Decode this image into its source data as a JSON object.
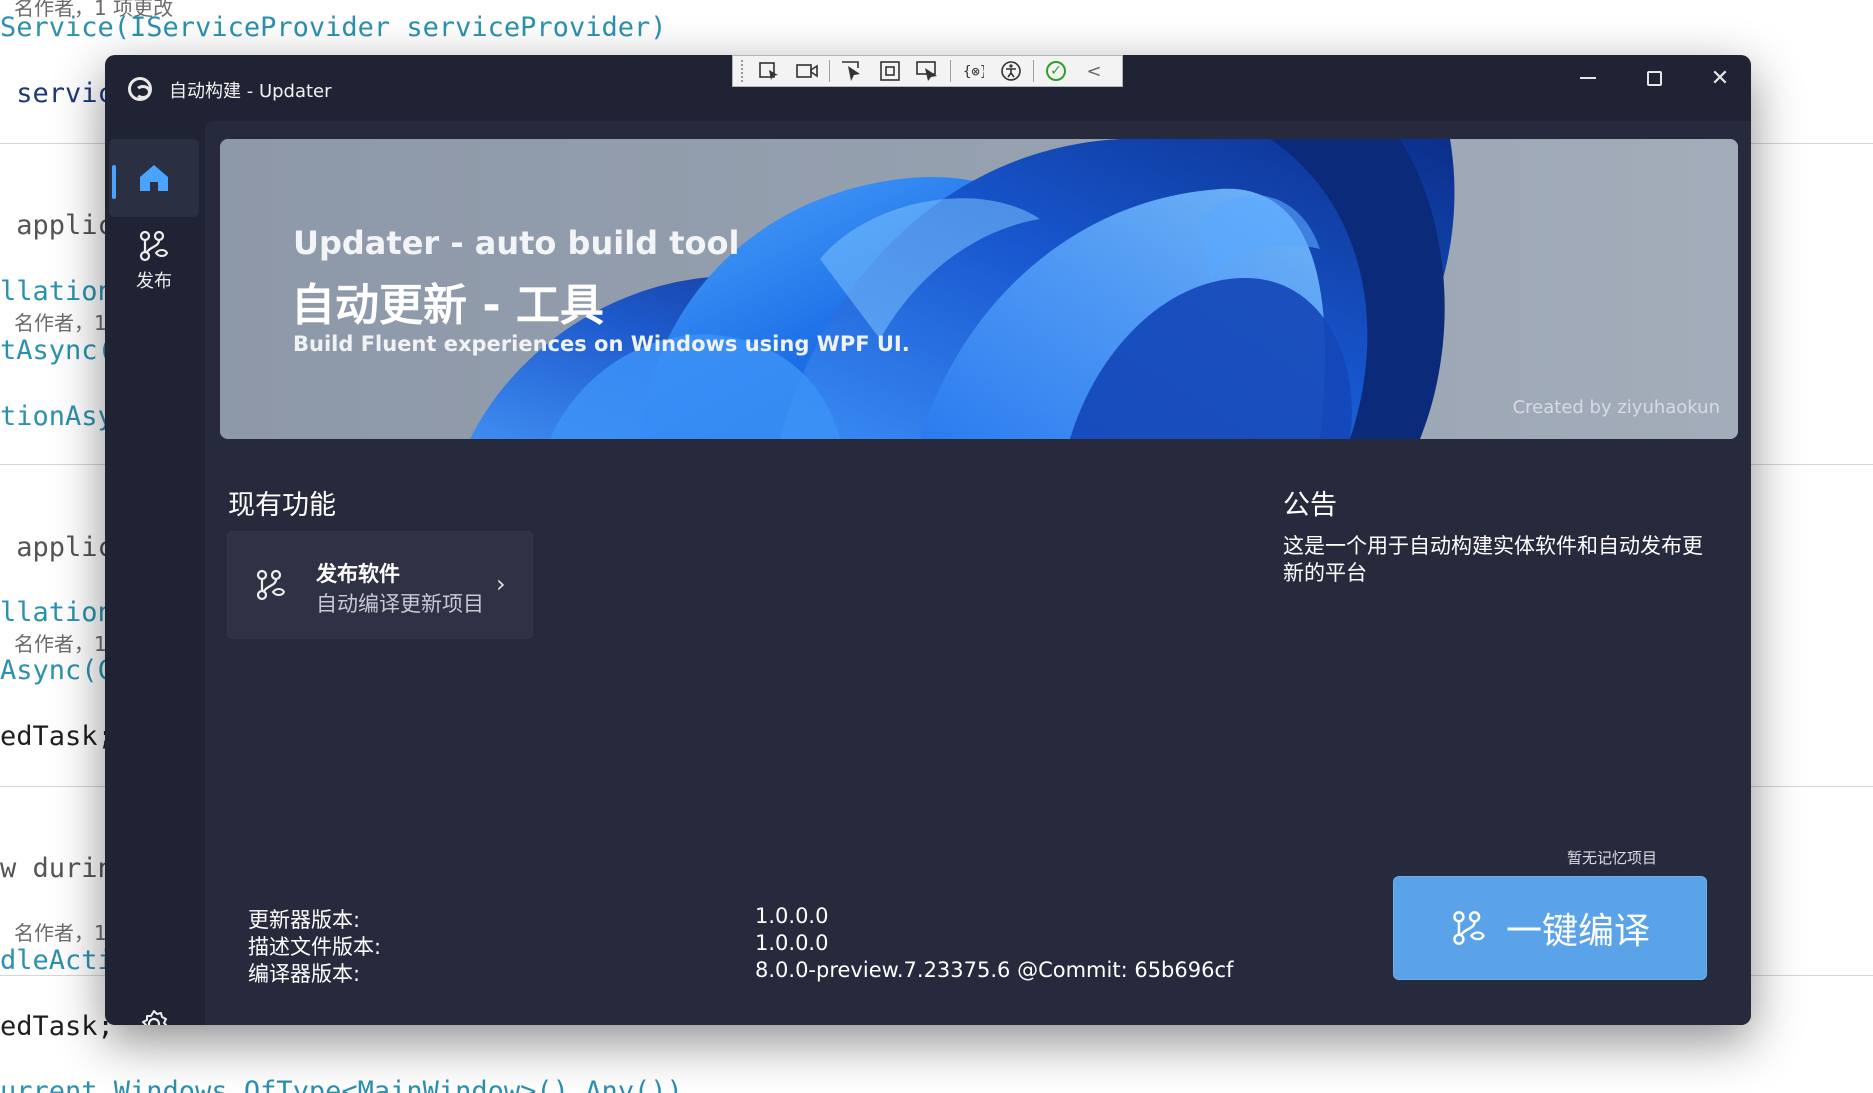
{
  "background_editor": {
    "lines": [
      {
        "code": "名作者，1 项更改",
        "type": "hint"
      },
      {
        "code": "Service(IServiceProvider serviceProvider)",
        "type": "code"
      },
      {
        "code": " servic",
        "type": "code"
      },
      {
        "code": " applic",
        "type": "code"
      },
      {
        "code": "llation",
        "type": "code"
      },
      {
        "code": "名作者，1",
        "type": "hint"
      },
      {
        "code": "tAsync(",
        "type": "code"
      },
      {
        "code": "tionAsy",
        "type": "code"
      },
      {
        "code": " applic",
        "type": "code"
      },
      {
        "code": "llation",
        "type": "code"
      },
      {
        "code": "名作者，1",
        "type": "hint"
      },
      {
        "code": "Async(C",
        "type": "code"
      },
      {
        "code": "edTask;",
        "type": "code"
      },
      {
        "code": "w durin",
        "type": "code"
      },
      {
        "code": "名作者，1",
        "type": "hint"
      },
      {
        "code": "dleActi",
        "type": "code"
      },
      {
        "code": "edTask;",
        "type": "code"
      },
      {
        "code": "urrent.Windows.OfType<MainWindow>().Any())",
        "type": "code"
      }
    ]
  },
  "window": {
    "title": "自动构建 - Updater",
    "minimize_glyph": "—",
    "close_glyph": "✕"
  },
  "debug_toolbar": {
    "icons": [
      "select-element-icon",
      "record-icon",
      "pointer-icon",
      "layout-adorner-icon",
      "track-focus-icon",
      "binding-failures-icon",
      "accessibility-icon",
      "checkmark-icon",
      "collapse-icon"
    ],
    "collapse_glyph": "<",
    "check_glyph": "✓"
  },
  "nav": {
    "home_label": "",
    "publish_label": "发布",
    "settings_label": "设置",
    "accent": "#4aa3ff"
  },
  "banner": {
    "en_title": "Updater - auto build tool",
    "cn_title": "自动更新 - 工具",
    "subtitle": "Build Fluent experiences on Windows using WPF UI.",
    "credit": "Created by ziyuhaokun"
  },
  "features": {
    "title": "现有功能",
    "card": {
      "title": "发布软件",
      "description": "自动编译更新项目",
      "chevron": "›"
    }
  },
  "notice": {
    "title": "公告",
    "text": "这是一个用于自动构建实体软件和自动发布更新的平台"
  },
  "versions": [
    {
      "label": "更新器版本:",
      "value": "1.0.0.0"
    },
    {
      "label": "描述文件版本:",
      "value": "1.0.0.0"
    },
    {
      "label": "编译器版本:",
      "value": "8.0.0-preview.7.23375.6 @Commit: 65b696cf"
    }
  ],
  "build": {
    "recent_label": "暂无记忆项目",
    "button_label": "一键编译",
    "button_color": "#5aa3e8"
  }
}
